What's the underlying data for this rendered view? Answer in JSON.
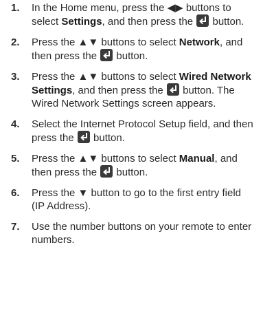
{
  "steps": [
    {
      "number": "1.",
      "segments": [
        {
          "t": "In the Home menu, press the ◀▶ buttons to select "
        },
        {
          "t": "Settings",
          "b": true
        },
        {
          "t": ", and then press the "
        },
        {
          "icon": "enter-button-icon"
        },
        {
          "t": " button."
        }
      ]
    },
    {
      "number": "2.",
      "segments": [
        {
          "t": "Press the ▲▼ buttons to select "
        },
        {
          "t": "Network",
          "b": true
        },
        {
          "t": ", and then press the "
        },
        {
          "icon": "enter-button-icon"
        },
        {
          "t": " button."
        }
      ]
    },
    {
      "number": "3.",
      "segments": [
        {
          "t": "Press the ▲▼ buttons to select "
        },
        {
          "t": "Wired Network Settings",
          "b": true
        },
        {
          "t": ", and then press the "
        },
        {
          "icon": "enter-button-icon"
        },
        {
          "t": " button. The Wired Network Settings screen appears."
        }
      ]
    },
    {
      "number": "4.",
      "segments": [
        {
          "t": "Select the Internet Protocol Setup field, and then press the "
        },
        {
          "icon": "enter-button-icon"
        },
        {
          "t": " button."
        }
      ]
    },
    {
      "number": "5.",
      "segments": [
        {
          "t": "Press the ▲▼ buttons to select "
        },
        {
          "t": "Manual",
          "b": true
        },
        {
          "t": ", and then press the "
        },
        {
          "icon": "enter-button-icon"
        },
        {
          "t": " button."
        }
      ]
    },
    {
      "number": "6.",
      "segments": [
        {
          "t": "Press the ▼ button to go to the first entry field (IP Address)."
        }
      ]
    },
    {
      "number": "7.",
      "segments": [
        {
          "t": "Use the number buttons on your remote to enter numbers."
        }
      ]
    }
  ],
  "colors": {
    "icon_bg": "#3a3a3a",
    "icon_fg": "#ffffff",
    "text": "#2a2a2a"
  }
}
